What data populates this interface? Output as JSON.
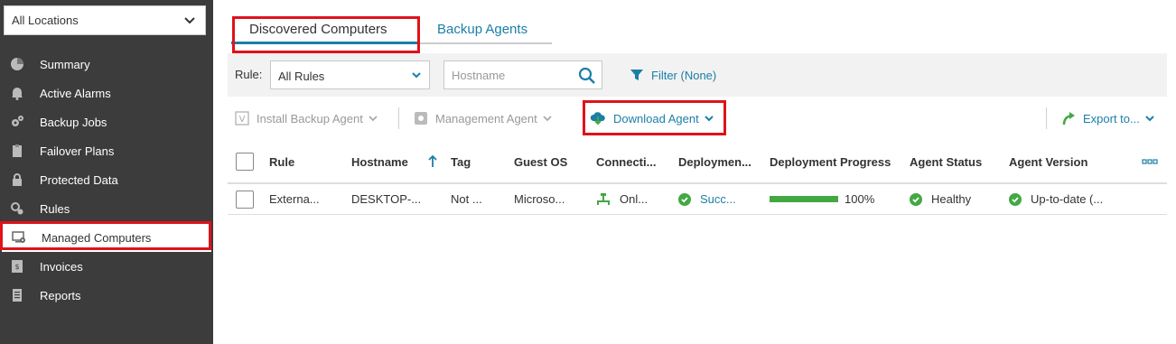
{
  "sidebar": {
    "location": "All Locations",
    "items": [
      {
        "label": "Summary",
        "icon": "pie-chart-icon"
      },
      {
        "label": "Active Alarms",
        "icon": "bell-icon"
      },
      {
        "label": "Backup Jobs",
        "icon": "gears-icon"
      },
      {
        "label": "Failover Plans",
        "icon": "clipboard-icon"
      },
      {
        "label": "Protected Data",
        "icon": "lock-icon"
      },
      {
        "label": "Rules",
        "icon": "search-gear-icon"
      },
      {
        "label": "Managed Computers",
        "icon": "computer-gear-icon",
        "active": true
      },
      {
        "label": "Invoices",
        "icon": "invoice-icon"
      },
      {
        "label": "Reports",
        "icon": "report-icon"
      }
    ]
  },
  "tabs": {
    "discovered": "Discovered Computers",
    "agents": "Backup Agents"
  },
  "filterbar": {
    "rule_label": "Rule:",
    "rule_value": "All Rules",
    "search_placeholder": "Hostname",
    "filter_label": "Filter (None)"
  },
  "toolbar": {
    "install": "Install Backup Agent",
    "management": "Management Agent",
    "download": "Download Agent",
    "export": "Export to..."
  },
  "table": {
    "columns": [
      "Rule",
      "Hostname",
      "Tag",
      "Guest OS",
      "Connecti...",
      "Deploymen...",
      "Deployment Progress",
      "Agent Status",
      "Agent Version"
    ],
    "rows": [
      {
        "rule": "Externa...",
        "hostname": "DESKTOP-...",
        "tag": "Not ...",
        "guest_os": "Microso...",
        "connection": "Onl...",
        "deployment": "Succ...",
        "progress": "100%",
        "progress_value": 1.0,
        "agent_status": "Healthy",
        "agent_version": "Up-to-date (..."
      }
    ]
  },
  "colors": {
    "accent": "#1a7fa8",
    "sidebar_bg": "#3c3c3c",
    "success": "#43a843",
    "highlight": "#e0121a"
  }
}
